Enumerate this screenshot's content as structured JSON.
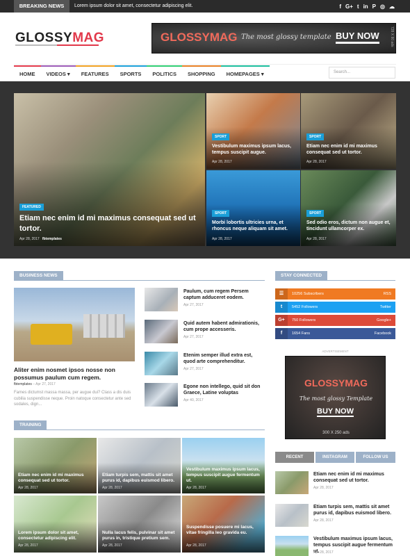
{
  "topbar": {
    "breaking_label": "BREAKING NEWS",
    "ticker_text": "Lorem ipsum dolor sit amet, consectetur adipiscing elit.",
    "social_icons": [
      "facebook-icon",
      "google-plus-icon",
      "twitter-icon",
      "linkedin-icon",
      "pinterest-icon",
      "instagram-icon",
      "soundcloud-icon"
    ],
    "social_glyphs": [
      "f",
      "G+",
      "t",
      "in",
      "P",
      "◎",
      "☁"
    ]
  },
  "header": {
    "logo_part1": "GLOSSY",
    "logo_part2": "MAG",
    "banner": {
      "logo": "GLOSSYMAG",
      "tagline": "The most glossy template",
      "cta": "BUY NOW",
      "size": "728 X 90 ads"
    }
  },
  "nav": {
    "items": [
      {
        "label": "HOME",
        "color": "#e2384a"
      },
      {
        "label": "VIDEOS ▾",
        "color": "#9b59b6"
      },
      {
        "label": "FEATURES",
        "color": "#f0a020"
      },
      {
        "label": "SPORTS",
        "color": "#1a9fd8"
      },
      {
        "label": "POLITICS",
        "color": "#2ecc71"
      },
      {
        "label": "SHOPPING",
        "color": "#e67e22"
      },
      {
        "label": "HOMEPAGES ▾",
        "color": "#1abc9c"
      }
    ],
    "search_placeholder": "Search..."
  },
  "hero": {
    "main": {
      "badge": "FEATURED",
      "title": "Etiam nec enim id mi maximus consequat sed ut tortor.",
      "date": "Apr 28, 2017",
      "author": "fbtemplates"
    },
    "tiles": [
      {
        "badge": "SPORT",
        "title": "Vestibulum maximus ipsum lacus, tempus suscipit augue.",
        "date": "Apr 28, 2017"
      },
      {
        "badge": "SPORT",
        "title": "Etiam nec enim id mi maximus consequat sed ut tortor.",
        "date": "Apr 28, 2017"
      },
      {
        "badge": "SPORT",
        "title": "Morbi lobortis ultricies urna, et rhoncus neque aliquam sit amet.",
        "date": "Apr 28, 2017"
      },
      {
        "badge": "SPORT",
        "title": "Sed odio eros, dictum non augue et, tincidunt ullamcorper ex.",
        "date": "Apr 28, 2017"
      }
    ]
  },
  "business": {
    "heading": "BUSINESS NEWS",
    "main": {
      "title": "Aliter enim nosmet ipsos nosse non possumus paulum cum regem.",
      "author": "fbtemplates",
      "date": "Apr 27, 2017",
      "excerpt": "Fames dictumst massa massa, per augue dui? Class a dis duis cubilia suspendisse neque. Proin natoque consectetur ante sed sodales, dign..."
    },
    "list": [
      {
        "title": "Paulum, cum regem Persem captum adduceret eodem.",
        "date": "Apr 27, 2017"
      },
      {
        "title": "Quid autem habent admirationis, cum prope accesseris.",
        "date": "Apr 27, 2017"
      },
      {
        "title": "Etenim semper illud extra est, quod arte comprehenditur.",
        "date": "Apr 27, 2017"
      },
      {
        "title": "Egone non intellego, quid sit don Graece, Latine voluptas",
        "date": "Apr 40, 2017"
      }
    ]
  },
  "training": {
    "heading": "TRAINING",
    "items": [
      {
        "title": "Etiam nec enim id mi maximus consequat sed ut tortor.",
        "date": "Apr 28, 2017"
      },
      {
        "title": "Etiam turpis sem, mattis sit amet purus id, dapibus euismod libero.",
        "date": "Apr 28, 2017"
      },
      {
        "title": "Vestibulum maximus ipsum lacus, tempus suscipit augue fermentum ut.",
        "date": "Apr 28, 2017"
      },
      {
        "title": "Lorem ipsum dolor sit amet, consectetur adipiscing elit.",
        "date": "Apr 28, 2017"
      },
      {
        "title": "Nulla lacus felis, pulvinar sit amet purus in, tristique pretium sem.",
        "date": "Apr 28, 2017"
      },
      {
        "title": "Suspendisse posuere mi lacus, vitae fringilla leo gravida eu.",
        "date": "Apr 28, 2017"
      }
    ]
  },
  "sidebar": {
    "stay_connected": "STAY CONNECTED",
    "social": [
      {
        "glyph": "☰",
        "label": "10256 Subscribers",
        "right": "RSS",
        "color": "#f07a22"
      },
      {
        "glyph": "t",
        "label": "5452 Followers",
        "right": "Twitter",
        "color": "#1da1f2"
      },
      {
        "glyph": "G+",
        "label": "750 Followers",
        "right": "Google+",
        "color": "#dd4b39"
      },
      {
        "glyph": "f",
        "label": "1654 Fans",
        "right": "Facebook",
        "color": "#3b5998"
      }
    ],
    "ad_label": "ADVERTISEMENT",
    "ad": {
      "logo": "GLOSSYMAG",
      "tagline": "The most glossy Template",
      "cta": "BUY NOW",
      "size": "300 X 250 ads"
    },
    "tabs": [
      "RECENT",
      "INSTAGRAM",
      "FOLLOW US"
    ],
    "recent": [
      {
        "title": "Etiam nec enim id mi maximus consequat sed ut tortor.",
        "date": "Apr 28, 2017"
      },
      {
        "title": "Etiam turpis sem, mattis sit amet purus id, dapibus euismod libero.",
        "date": "Apr 28, 2017"
      },
      {
        "title": "Vestibulum maximus ipsum lacus, tempus suscipit augue fermentum ut.",
        "date": "Apr 28, 2017"
      }
    ]
  }
}
